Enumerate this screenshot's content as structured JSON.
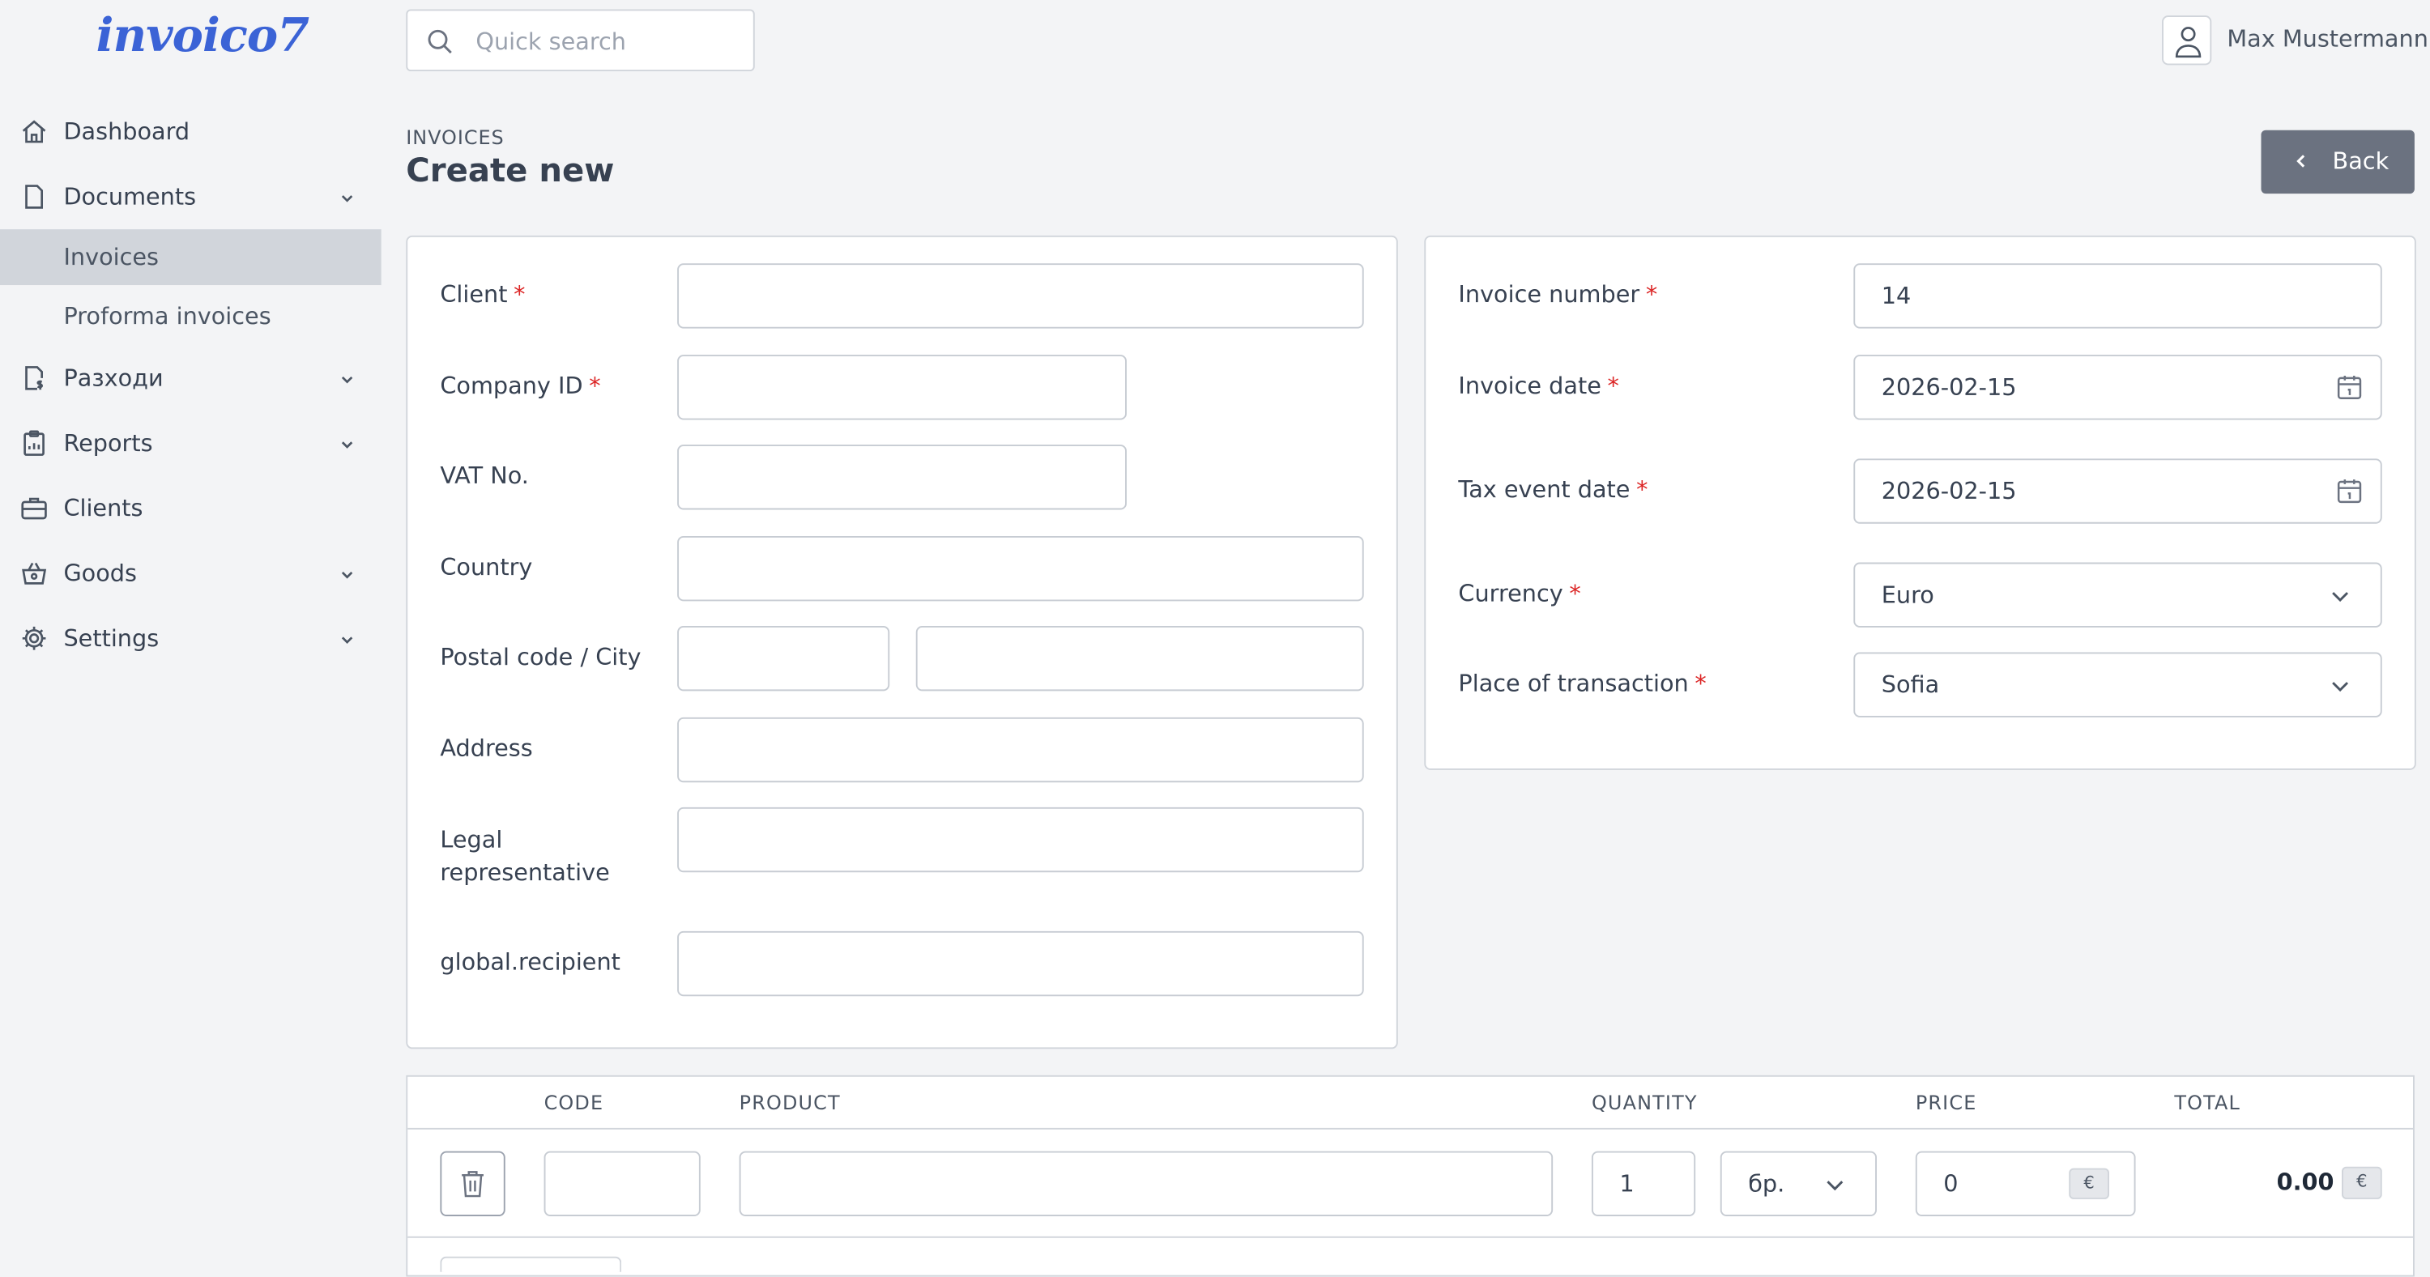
{
  "app": {
    "logo_text": "invoico7"
  },
  "search": {
    "placeholder": "Quick search"
  },
  "user": {
    "name": "Max Mustermann"
  },
  "sidebar": {
    "items": [
      {
        "label": "Dashboard",
        "icon": "home-icon"
      },
      {
        "label": "Documents",
        "icon": "document-icon",
        "expandable": true
      },
      {
        "label": "Разходи",
        "icon": "expense-icon",
        "expandable": true
      },
      {
        "label": "Reports",
        "icon": "clipboard-icon",
        "expandable": true
      },
      {
        "label": "Clients",
        "icon": "briefcase-icon"
      },
      {
        "label": "Goods",
        "icon": "basket-icon",
        "expandable": true
      },
      {
        "label": "Settings",
        "icon": "gear-icon",
        "expandable": true
      }
    ],
    "documents_sub": [
      {
        "label": "Invoices",
        "active": true
      },
      {
        "label": "Proforma invoices",
        "active": false
      }
    ]
  },
  "page": {
    "breadcrumb": "INVOICES",
    "title": "Create new",
    "back_label": "Back"
  },
  "client_form": {
    "client_label": "Client",
    "company_id_label": "Company ID",
    "vat_label": "VAT No.",
    "country_label": "Country",
    "postal_city_label": "Postal code / City",
    "address_label": "Address",
    "legal_rep_label": "Legal representative",
    "recipient_label": "global.recipient",
    "required_mark": "*"
  },
  "invoice_form": {
    "number_label": "Invoice number",
    "number_value": "14",
    "date_label": "Invoice date",
    "date_value": "2026-02-15",
    "tax_date_label": "Tax event date",
    "tax_date_value": "2026-02-15",
    "currency_label": "Currency",
    "currency_value": "Euro",
    "place_label": "Place of transaction",
    "place_value": "Sofia"
  },
  "items_table": {
    "headers": {
      "code": "CODE",
      "product": "PRODUCT",
      "quantity": "QUANTITY",
      "price": "PRICE",
      "total": "TOTAL"
    },
    "rows": [
      {
        "code": "",
        "product": "",
        "quantity": "1",
        "unit": "бр.",
        "price": "0",
        "currency_symbol": "€",
        "total": "0.00"
      }
    ]
  },
  "colors": {
    "accent": "#3b63d6",
    "required": "#dc2626",
    "back_button": "#6b7280",
    "active_nav": "#d1d5db"
  }
}
